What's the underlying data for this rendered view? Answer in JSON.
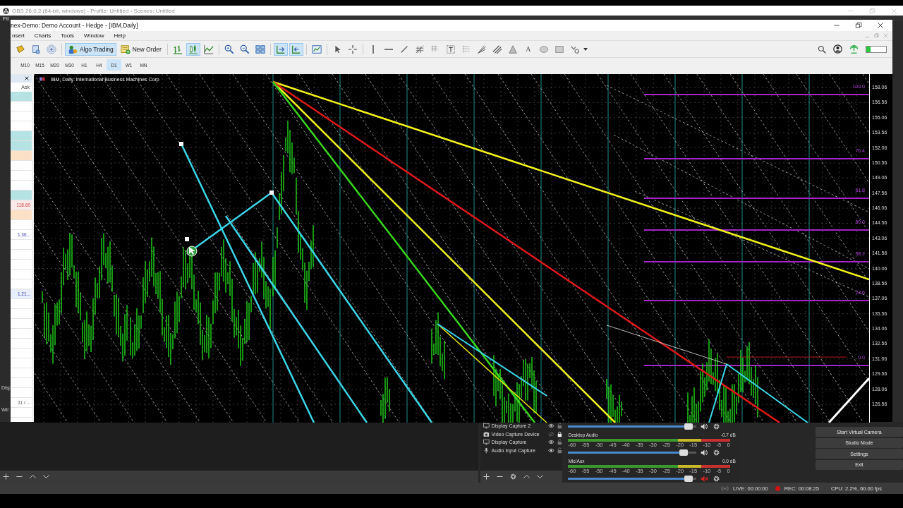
{
  "obs": {
    "title": "OBS 26.0.2 (64-bit, windows) - Profile: Untitled - Scenes: Untitled",
    "menu": [
      "Fil"
    ],
    "side_labels": [
      "Disp",
      "Wir"
    ],
    "sources": [
      {
        "name": "Display Capture 2",
        "visible": true,
        "locked": false
      },
      {
        "name": "Video Capture Device",
        "visible": false,
        "locked": true
      },
      {
        "name": "Display Capture",
        "visible": true,
        "locked": false
      },
      {
        "name": "Audio Input Capture",
        "visible": true,
        "locked": false
      }
    ],
    "mixer": [
      {
        "level": 0.97,
        "muted": false
      },
      {
        "name": "Desktop Audio",
        "reading": "-0.7 dB",
        "scale": [
          "-60",
          "-55",
          "-50",
          "-45",
          "-40",
          "-35",
          "-30",
          "-25",
          "-20",
          "-15",
          "-10",
          "-5",
          "0"
        ],
        "level": 0.93,
        "muted": false
      },
      {
        "name": "Mic/Aux",
        "reading": "0.0 dB",
        "scale": [
          "-60",
          "-55",
          "-50",
          "-45",
          "-40",
          "-35",
          "-30",
          "-25",
          "-20",
          "-15",
          "-10",
          "-5",
          "0"
        ],
        "level": 0.97,
        "muted": true
      }
    ],
    "controls": [
      "Start Virtual Camera",
      "Studio Mode",
      "Settings",
      "Exit"
    ],
    "status": {
      "live": "LIVE: 00:00:00",
      "rec": "REC: 00:08:25",
      "cpu": "CPU: 2.2%, 60.00 fps"
    }
  },
  "terminal": {
    "title": "nex-Demo: Demo Account - Hedge - [IBM,Daily]",
    "menu": [
      "nsert",
      "Charts",
      "Tools",
      "Window",
      "Help"
    ],
    "toolbar": [
      {
        "kind": "icon",
        "pressed": false
      },
      {
        "kind": "icon",
        "pressed": false
      },
      {
        "kind": "icon",
        "pressed": false
      },
      {
        "kind": "separator"
      },
      {
        "kind": "button",
        "label": "Algo Trading",
        "pressed": true
      },
      {
        "kind": "button",
        "label": "New Order",
        "pressed": false
      },
      {
        "kind": "separator"
      },
      {
        "kind": "icon",
        "pressed": false
      },
      {
        "kind": "icon",
        "pressed": true
      },
      {
        "kind": "icon",
        "pressed": false
      },
      {
        "kind": "separator"
      },
      {
        "kind": "icon",
        "pressed": false
      },
      {
        "kind": "icon",
        "pressed": false
      },
      {
        "kind": "icon",
        "pressed": false
      },
      {
        "kind": "separator"
      },
      {
        "kind": "icon",
        "pressed": true
      },
      {
        "kind": "icon",
        "pressed": true
      },
      {
        "kind": "separator"
      },
      {
        "kind": "icon",
        "pressed": false
      },
      {
        "kind": "separator"
      },
      {
        "kind": "icon",
        "pressed": false
      },
      {
        "kind": "icon",
        "pressed": false
      },
      {
        "kind": "separator"
      },
      {
        "kind": "icon",
        "pressed": false
      },
      {
        "kind": "icon",
        "pressed": false
      },
      {
        "kind": "icon",
        "pressed": false
      },
      {
        "kind": "icon",
        "pressed": false
      },
      {
        "kind": "icon",
        "pressed": false
      },
      {
        "kind": "icon",
        "pressed": false
      },
      {
        "kind": "icon",
        "pressed": false
      },
      {
        "kind": "icon",
        "pressed": false
      },
      {
        "kind": "icon",
        "pressed": false
      },
      {
        "kind": "icon",
        "pressed": false
      },
      {
        "kind": "glyph",
        "label": "A",
        "pressed": false
      },
      {
        "kind": "icon",
        "pressed": false
      },
      {
        "kind": "icon",
        "pressed": false
      },
      {
        "kind": "icon",
        "pressed": false
      }
    ],
    "timeframes": [
      {
        "label": "M10",
        "selected": false
      },
      {
        "label": "M15",
        "selected": false
      },
      {
        "label": "M20",
        "selected": false
      },
      {
        "label": "M30",
        "selected": false
      },
      {
        "label": "H1",
        "selected": false
      },
      {
        "label": "H4",
        "selected": false
      },
      {
        "label": "D1",
        "selected": true
      },
      {
        "label": "W1",
        "selected": false
      },
      {
        "label": "MN",
        "selected": false
      }
    ],
    "market_watch": {
      "header": "Ask",
      "rows": [
        {
          "color": "#b5e2e2"
        },
        {
          "color": "#ffffff"
        },
        {
          "color": "#ffffff"
        },
        {
          "color": "#ffffff"
        },
        {
          "color": "#b5e2e2"
        },
        {
          "color": "#b5e2e2"
        },
        {
          "color": "#fde1c6"
        },
        {
          "color": "#ffffff"
        },
        {
          "color": "#ffffff"
        },
        {
          "color": "#ffffff"
        },
        {
          "color": "#b5e2e2"
        },
        {
          "color": "#fbeaea",
          "text": "118.60",
          "kind": "down"
        },
        {
          "color": "#fde1c6"
        },
        {
          "color": "#ffffff"
        },
        {
          "color": "#ffffff",
          "text": "1.36...",
          "kind": "up"
        },
        {
          "color": "#ffffff"
        },
        {
          "color": "#ffffff"
        },
        {
          "color": "#ffffff"
        },
        {
          "color": "#ffffff"
        },
        {
          "color": "#ffffff"
        },
        {
          "color": "#e8eefb",
          "text": "1.21...",
          "kind": "up"
        },
        {
          "color": "#ffffff"
        },
        {
          "color": "#ffffff"
        },
        {
          "color": "#ffffff"
        },
        {
          "color": "#ffffff"
        },
        {
          "color": "#ffffff"
        },
        {
          "color": "#ffffff"
        },
        {
          "color": "#ffffff"
        },
        {
          "color": "#ffffff"
        },
        {
          "color": "#ffffff"
        },
        {
          "color": "#ffffff"
        },
        {
          "color": "#ffffff",
          "text": "31 / ...",
          "kind": "plain"
        },
        {
          "color": "#ffffff"
        }
      ]
    },
    "chart": {
      "header": "IBM, Daily:  International Business Machines Corp",
      "fib_levels": [
        "100.0",
        "76.4",
        "61.8",
        "50.0",
        "38.2",
        "23.6",
        "0.0"
      ],
      "price_axis": [
        "158.06",
        "156.56",
        "155.06",
        "153.56",
        "152.06",
        "150.56",
        "149.06",
        "147.56",
        "146.06",
        "144.56",
        "143.06",
        "141.56",
        "140.06",
        "138.56",
        "137.06",
        "135.56",
        "134.06",
        "132.56",
        "131.06",
        "129.56",
        "128.06",
        "126.56"
      ]
    }
  }
}
